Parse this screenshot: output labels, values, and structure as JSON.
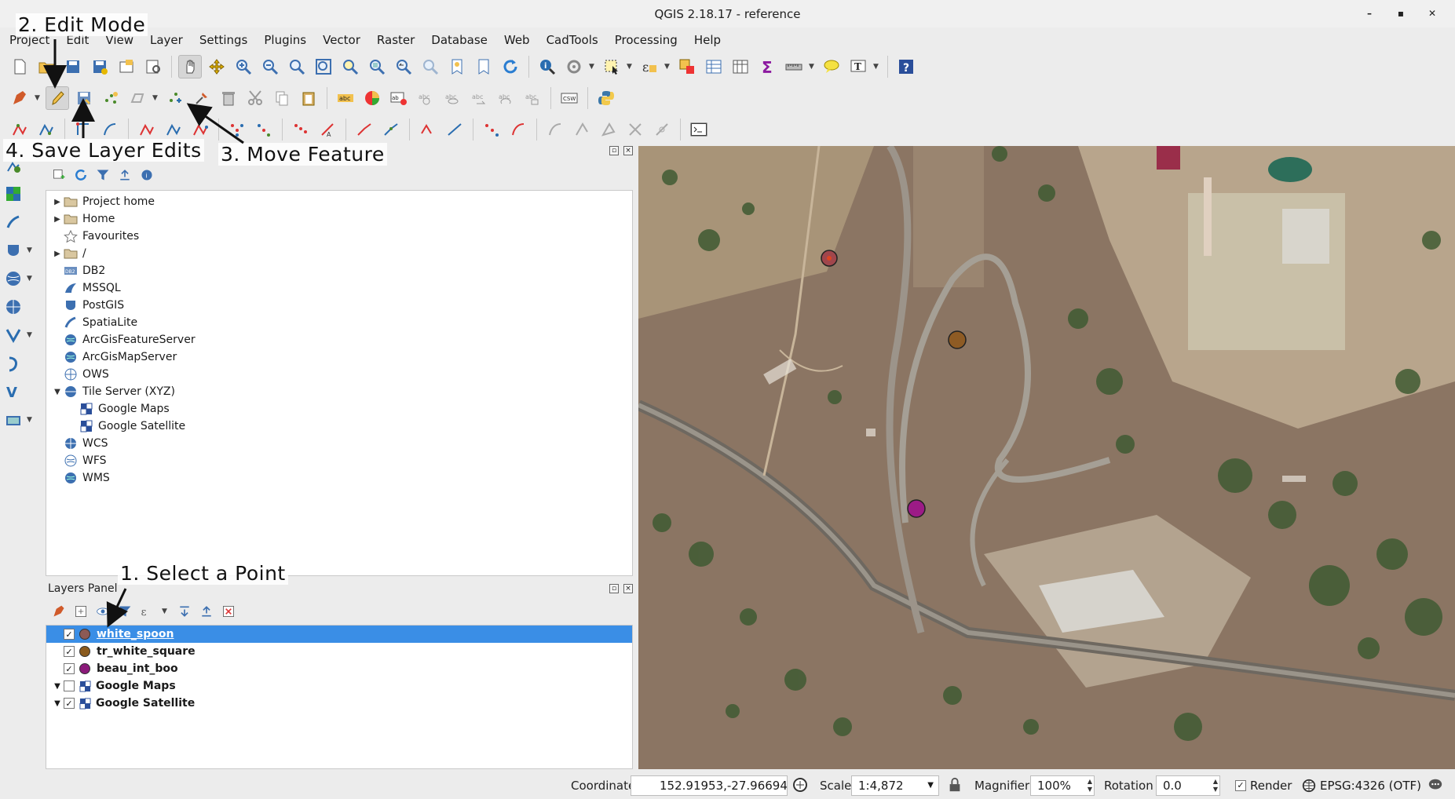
{
  "window": {
    "title": "QGIS 2.18.17 - reference",
    "controls": [
      "–",
      "▪",
      "✕"
    ]
  },
  "menu": [
    "Project",
    "Edit",
    "View",
    "Layer",
    "Settings",
    "Plugins",
    "Vector",
    "Raster",
    "Database",
    "Web",
    "CadTools",
    "Processing",
    "Help"
  ],
  "annotations": {
    "edit_mode": "2. Edit Mode",
    "save_edits": "4. Save Layer Edits",
    "move_feature": "3. Move Feature",
    "select_point": "1. Select a Point"
  },
  "toolbar_icons": {
    "row1": [
      "new-project-icon",
      "open-project-icon",
      "save-project-icon",
      "save-as-icon",
      "new-print-composer-icon",
      "composer-manager-icon",
      "pan-icon",
      "pan-to-selection-icon",
      "zoom-in-icon",
      "zoom-out-icon",
      "zoom-actual-icon",
      "zoom-full-icon",
      "zoom-to-selection-icon",
      "zoom-to-layer-icon",
      "zoom-last-icon",
      "zoom-next-icon",
      "new-bookmark-icon",
      "show-bookmarks-icon",
      "refresh-icon",
      "identify-icon",
      "run-action-icon",
      "select-features-icon",
      "select-by-expression-icon",
      "deselect-icon",
      "attribute-table-icon",
      "field-calculator-icon",
      "statistics-icon",
      "measure-icon",
      "map-tips-icon",
      "text-annotation-icon",
      "help-icon"
    ],
    "row2": [
      "current-edits-icon",
      "toggle-editing-icon",
      "save-layer-edits-icon",
      "add-feature-icon",
      "add-part-icon",
      "move-feature-icon",
      "node-tool-icon",
      "delete-selected-icon",
      "cut-features-icon",
      "copy-features-icon",
      "paste-features-icon",
      "label-icon",
      "diagram-icon",
      "pin-labels-icon",
      "show-hide-labels-icon",
      "move-label-icon",
      "rotate-label-icon",
      "change-label-icon",
      "metasearch-icon",
      "python-console-icon"
    ],
    "row3": [
      "digitize-1-icon",
      "digitize-2-icon",
      "digitize-3-icon",
      "digitize-4-icon",
      "digitize-5-icon",
      "digitize-6-icon",
      "digitize-7-icon",
      "digitize-8-icon",
      "digitize-9-icon",
      "digitize-10-icon",
      "digitize-11-icon",
      "digitize-12-icon",
      "digitize-13-icon",
      "digitize-14-icon",
      "digitize-15-icon",
      "digitize-16-icon",
      "digitize-17-icon",
      "digitize-18-icon",
      "digitize-19-icon",
      "digitize-20-icon",
      "digitize-21-icon",
      "terminal-icon"
    ]
  },
  "left_toolbar": [
    "add-delimited-text-icon",
    "add-raster-layer-icon",
    "add-spatialite-icon",
    "add-postgis-icon",
    "add-wms-icon",
    "add-wcs-icon",
    "add-wfs-icon",
    "new-gpx-icon",
    "add-virtual-layer-icon",
    "add-oracle-icon"
  ],
  "browser": {
    "items": [
      {
        "label": "Project home",
        "icon": "folder-icon",
        "expand": "▶",
        "child": false
      },
      {
        "label": "Home",
        "icon": "folder-icon",
        "expand": "▶",
        "child": false
      },
      {
        "label": "Favourites",
        "icon": "star-icon",
        "expand": "",
        "child": false
      },
      {
        "label": "/",
        "icon": "folder-icon",
        "expand": "▶",
        "child": false
      },
      {
        "label": "DB2",
        "icon": "db2-icon",
        "expand": "",
        "child": false
      },
      {
        "label": "MSSQL",
        "icon": "mssql-icon",
        "expand": "",
        "child": false
      },
      {
        "label": "PostGIS",
        "icon": "postgis-icon",
        "expand": "",
        "child": false
      },
      {
        "label": "SpatiaLite",
        "icon": "spatialite-icon",
        "expand": "",
        "child": false
      },
      {
        "label": "ArcGisFeatureServer",
        "icon": "globe-icon",
        "expand": "",
        "child": false
      },
      {
        "label": "ArcGisMapServer",
        "icon": "globe-icon",
        "expand": "",
        "child": false
      },
      {
        "label": "OWS",
        "icon": "ows-icon",
        "expand": "",
        "child": false
      },
      {
        "label": "Tile Server (XYZ)",
        "icon": "globe-icon",
        "expand": "▼",
        "child": false
      },
      {
        "label": "Google Maps",
        "icon": "tile-icon",
        "expand": "",
        "child": true
      },
      {
        "label": "Google Satellite",
        "icon": "tile-icon",
        "expand": "",
        "child": true
      },
      {
        "label": "WCS",
        "icon": "globe-icon",
        "expand": "",
        "child": false
      },
      {
        "label": "WFS",
        "icon": "globe-icon",
        "expand": "",
        "child": false
      },
      {
        "label": "WMS",
        "icon": "globe-icon",
        "expand": "",
        "child": false
      }
    ]
  },
  "layers": {
    "title": "Layers Panel",
    "items": [
      {
        "label": "white_spoon",
        "checked": "✓",
        "color": "#8c5a55",
        "expand": "",
        "selected": true,
        "kind": "point"
      },
      {
        "label": "tr_white_square",
        "checked": "✓",
        "color": "#8a5a1e",
        "expand": "",
        "selected": false,
        "kind": "point"
      },
      {
        "label": "beau_int_boo",
        "checked": "✓",
        "color": "#8b1a7a",
        "expand": "",
        "selected": false,
        "kind": "point"
      },
      {
        "label": "Google Maps",
        "checked": "",
        "color": "",
        "expand": "▼",
        "selected": false,
        "kind": "tile"
      },
      {
        "label": "Google Satellite",
        "checked": "✓",
        "color": "",
        "expand": "▼",
        "selected": false,
        "kind": "tile"
      }
    ]
  },
  "map_points": [
    {
      "name": "white_spoon",
      "color": "#a0464c"
    },
    {
      "name": "tr_white_square",
      "color": "#8e5b24"
    },
    {
      "name": "beau_int_boo",
      "color": "#9c1b86"
    }
  ],
  "status": {
    "coordinate_label": "Coordinate",
    "coordinate_value": "152.91953,-27.96694",
    "scale_label": "Scale",
    "scale_value": "1:4,872",
    "magnifier_label": "Magnifier",
    "magnifier_value": "100%",
    "rotation_label": "Rotation",
    "rotation_value": "0.0",
    "render_label": "Render",
    "render_checked": "✓",
    "crs_value": "EPSG:4326 (OTF)"
  }
}
